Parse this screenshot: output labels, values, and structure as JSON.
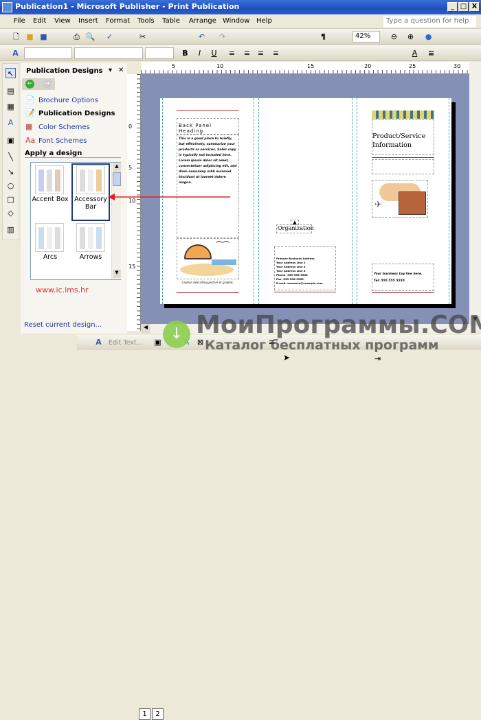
{
  "window": {
    "title": "Publication1 - Microsoft Publisher - Print Publication",
    "minimize": "_",
    "maximize": "□",
    "close": "X"
  },
  "menu": [
    "File",
    "Edit",
    "View",
    "Insert",
    "Format",
    "Tools",
    "Table",
    "Arrange",
    "Window",
    "Help"
  ],
  "help_placeholder": "Type a question for help",
  "toolbar": {
    "zoom": "42%"
  },
  "taskpane": {
    "title": "Publication Designs",
    "links": [
      "Brochure Options",
      "Publication Designs",
      "Color Schemes",
      "Font Schemes"
    ],
    "section": "Apply a design",
    "designs": [
      "Accent Box",
      "Accessory Bar",
      "Arcs",
      "Arrows"
    ],
    "selected": "Accessory Bar",
    "reset": "Reset current design...",
    "website": "www.ic.ims.hr"
  },
  "ruler": {
    "h": [
      "5",
      "10",
      "15",
      "20",
      "25",
      "30"
    ],
    "v": [
      "0",
      "5",
      "10",
      "15"
    ]
  },
  "brochure": {
    "back_heading": "Back Panel Heading",
    "back_body1": "This is a good place to briefly, but effectively, summarize your products or services. Sales copy is typically not included here.",
    "back_body2": "Lorem ipsum dolor sit amet, consectetuer adipiscing elit, sed diam nonummy nibh euismod tincidunt ut laoreet dolore magna.",
    "caption": "Caption describing picture or graphic.",
    "organization": "Organization",
    "address": [
      "Primary Business Address",
      "Your Address Line 2",
      "Your Address Line 3",
      "Your Address Line 4"
    ],
    "contact": [
      "Phone: 555-555-5555",
      "Fax: 555-555-5555",
      "E-mail: someone@example.com"
    ],
    "product_title": "Product/Service Information",
    "tagline": "Your business tag line here.",
    "tel": "Tel: 555 555 5555"
  },
  "bottombar": {
    "edit_text": "Edit Text..."
  },
  "pages": [
    "1",
    "2"
  ],
  "watermark": {
    "line1": "МоиПрограммы.COM",
    "line2": "Каталог бесплатных программ"
  },
  "colors": {
    "titlebar": "#1f4fbf",
    "canvas": "#8590b7",
    "accent_red": "#a33333",
    "link": "#22359a"
  }
}
